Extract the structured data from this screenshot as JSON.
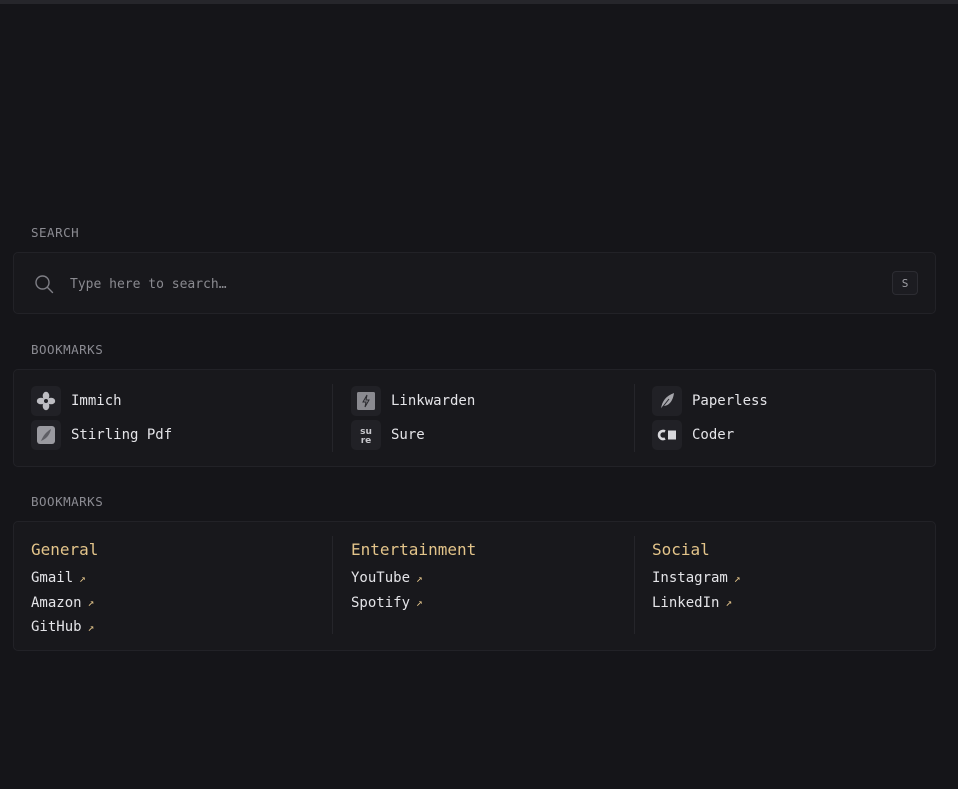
{
  "search": {
    "section_label": "SEARCH",
    "placeholder": "Type here to search…",
    "shortcut_key": "S"
  },
  "apps": {
    "section_label": "BOOKMARKS",
    "items": [
      {
        "label": "Immich",
        "icon": "immich-pinwheel-icon"
      },
      {
        "label": "Linkwarden",
        "icon": "linkwarden-icon"
      },
      {
        "label": "Paperless",
        "icon": "paperless-leaf-icon"
      },
      {
        "label": "Stirling Pdf",
        "icon": "stirling-pdf-icon"
      },
      {
        "label": "Sure",
        "icon": "sure-logo-icon"
      },
      {
        "label": "Coder",
        "icon": "coder-logo-icon"
      }
    ]
  },
  "bookmarks": {
    "section_label": "BOOKMARKS",
    "groups": [
      {
        "title": "General",
        "links": [
          "Gmail",
          "Amazon",
          "GitHub"
        ]
      },
      {
        "title": "Entertainment",
        "links": [
          "YouTube",
          "Spotify"
        ]
      },
      {
        "title": "Social",
        "links": [
          "Instagram",
          "LinkedIn"
        ]
      }
    ],
    "link_arrow": "↗"
  },
  "colors": {
    "background": "#151519",
    "card": "#18181c",
    "accent": "#e3c48a",
    "muted": "#8b8b92"
  },
  "sure_logo_text": "sure"
}
